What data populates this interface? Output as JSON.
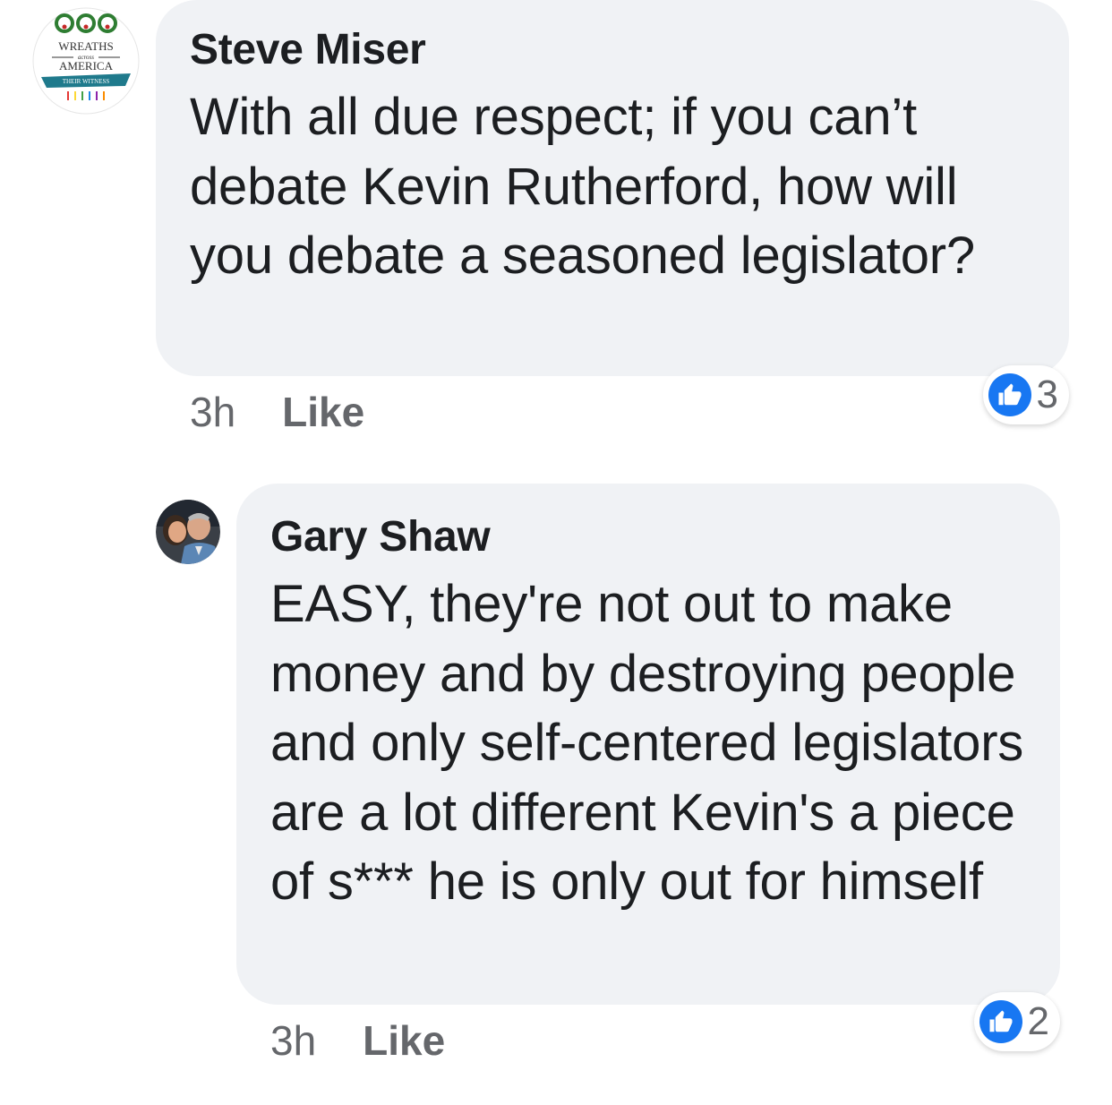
{
  "colors": {
    "bubble": "#f0f2f5",
    "text": "#1c1e21",
    "meta": "#65676b",
    "like_blue": "#1877f2"
  },
  "comments": [
    {
      "author": "Steve Miser",
      "avatar": {
        "icon": "wreaths-across-america-logo",
        "logo_text": [
          "WREATHS",
          "across",
          "AMERICA",
          "THEIR WITNESS"
        ]
      },
      "text": "With all due respect; if you can’t debate Kevin Rutherford, how will you debate a seasoned legislator?",
      "time": "3h",
      "like_label": "Like",
      "reaction_icon": "like-icon",
      "reaction_count": "3"
    },
    {
      "author": "Gary Shaw",
      "avatar": {
        "icon": "user-photo-avatar"
      },
      "text": "EASY, they're not out to make money and by destroying people and only self-centered legislators are a lot different Kevin's a piece of s*** he is only out for himself",
      "time": "3h",
      "like_label": "Like",
      "reaction_icon": "like-icon",
      "reaction_count": "2"
    }
  ]
}
